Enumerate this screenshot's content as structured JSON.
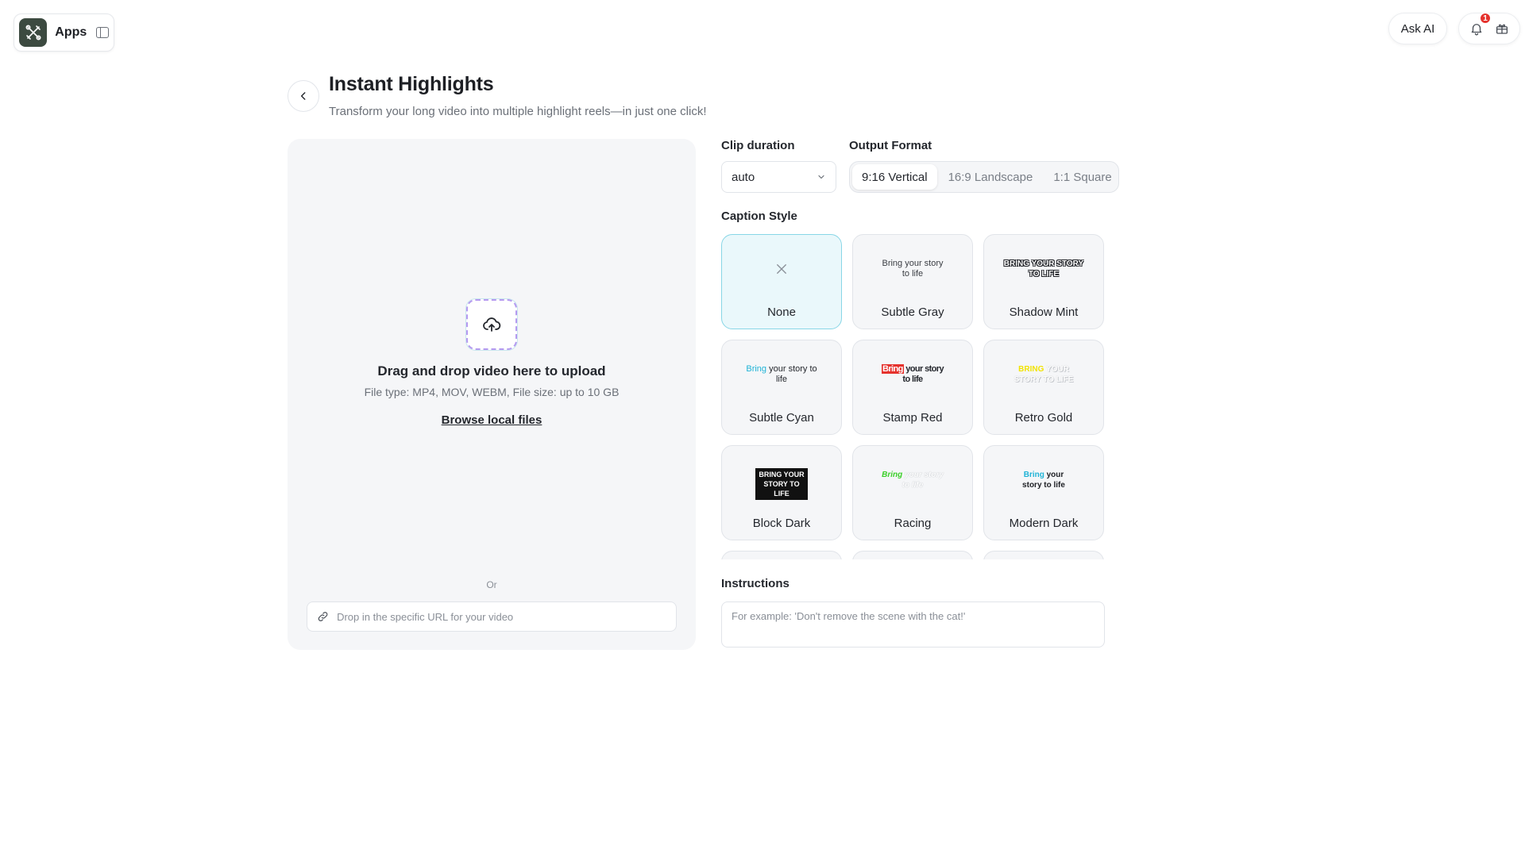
{
  "topbar": {
    "apps_label": "Apps",
    "ask_ai_label": "Ask AI",
    "notification_count": "1"
  },
  "header": {
    "title": "Instant Highlights",
    "subtitle": "Transform your long video into multiple highlight reels—in just one click!"
  },
  "upload": {
    "drop_title": "Drag and drop video here to upload",
    "file_info": "File type: MP4, MOV, WEBM, File size: up to 10 GB",
    "browse_label": "Browse local files",
    "or_label": "Or",
    "url_placeholder": "Drop in the specific URL for your video"
  },
  "settings": {
    "clip_duration_label": "Clip duration",
    "clip_duration_value": "auto",
    "output_format_label": "Output Format",
    "formats": [
      "9:16 Vertical",
      "16:9 Landscape",
      "1:1 Square"
    ],
    "selected_format": "9:16 Vertical",
    "caption_style_label": "Caption Style",
    "caption_styles": [
      {
        "name": "None",
        "preview": ""
      },
      {
        "name": "Subtle Gray",
        "preview": "Bring your story to life"
      },
      {
        "name": "Shadow Mint",
        "preview": "BRING YOUR STORY TO LIFE"
      },
      {
        "name": "Subtle Cyan",
        "preview": "Bring your story to life"
      },
      {
        "name": "Stamp Red",
        "preview": "Bring your story to life"
      },
      {
        "name": "Retro Gold",
        "preview": "BRING YOUR STORY TO LIFE"
      },
      {
        "name": "Block Dark",
        "preview": "BRING YOUR STORY TO LIFE"
      },
      {
        "name": "Racing",
        "preview": "Bring your story to life"
      },
      {
        "name": "Modern Dark",
        "preview": "Bring your story to life"
      }
    ],
    "selected_caption_style": "None",
    "instructions_label": "Instructions",
    "instructions_placeholder": "For example: 'Don't remove the scene with the cat!'"
  },
  "colors": {
    "accent_selected_bg": "#eaf8fb",
    "accent_selected_border": "#88d6e6",
    "notification_red": "#e5322d",
    "subtle_cyan": "#1fb3d6",
    "stamp_red": "#e5322d",
    "retro_gold": "#f2e300",
    "racing_green": "#3ccf2a"
  }
}
